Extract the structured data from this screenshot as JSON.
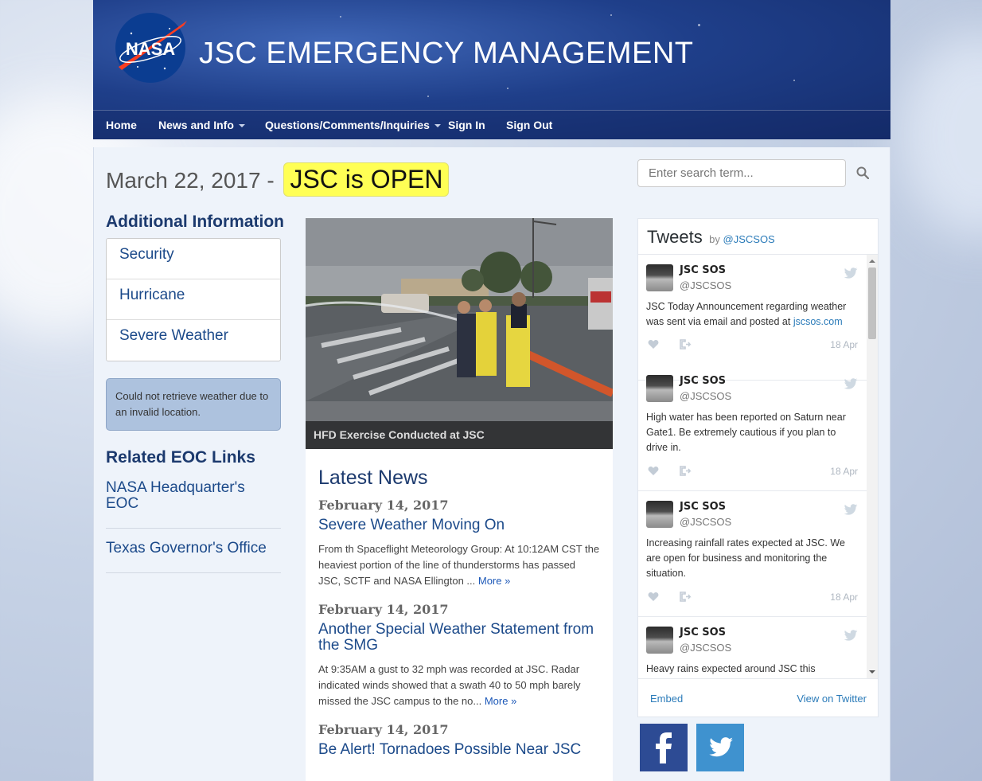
{
  "header": {
    "logo_text": "NASA",
    "title": "JSC EMERGENCY MANAGEMENT"
  },
  "nav": {
    "items": [
      {
        "label": "Home",
        "dropdown": false
      },
      {
        "label": "News and Info",
        "dropdown": true
      },
      {
        "label": "Questions/Comments/Inquiries",
        "dropdown": true
      },
      {
        "label": "Sign In",
        "dropdown": false
      },
      {
        "label": "Sign Out",
        "dropdown": false
      }
    ]
  },
  "status": {
    "date": "March 22, 2017 -",
    "badge": "JSC is OPEN",
    "badge_color": "#ffff55"
  },
  "search": {
    "placeholder": "Enter search term...",
    "icon": "search-icon"
  },
  "additional_info": {
    "title": "Additional Information",
    "items": [
      "Security",
      "Hurricane",
      "Severe Weather"
    ]
  },
  "weather": {
    "message": "Could not retrieve weather due to an invalid location."
  },
  "eoc": {
    "title": "Related EOC Links",
    "links": [
      "NASA Headquarter's EOC",
      "Texas Governor's Office"
    ]
  },
  "feature": {
    "caption": "HFD Exercise Conducted at JSC"
  },
  "news": {
    "title": "Latest News",
    "more_label": "More »",
    "items": [
      {
        "date": "February 14, 2017",
        "headline": "Severe Weather Moving On",
        "body": "From th Spaceflight Meteorology Group: At 10:12AM CST the heaviest portion of the line of thunderstorms has passed JSC, SCTF and NASA Ellington ..."
      },
      {
        "date": "February 14, 2017",
        "headline": "Another Special Weather Statement from the SMG",
        "body": "At 9:35AM a gust to 32 mph was recorded at JSC. Radar indicated winds showed that a swath 40 to 50 mph barely missed the JSC campus to the no..."
      },
      {
        "date": "February 14, 2017",
        "headline": "Be Alert! Tornadoes Possible Near JSC",
        "body": ""
      }
    ]
  },
  "tweets": {
    "title": "Tweets",
    "by": "by",
    "handle": "@JSCSOS",
    "embed_label": "Embed",
    "view_label": "View on Twitter",
    "items": [
      {
        "name": "JSC SOS",
        "handle": "@JSCSOS",
        "text": "JSC Today Announcement regarding weather was sent via email and posted at ",
        "link": "jscsos.com",
        "date": "18 Apr"
      },
      {
        "name": "JSC SOS",
        "handle": "@JSCSOS",
        "text": "High water has been reported on Saturn near Gate1. Be extremely cautious if you plan to drive in.",
        "link": "",
        "date": "18 Apr"
      },
      {
        "name": "JSC SOS",
        "handle": "@JSCSOS",
        "text": "Increasing rainfall rates expected at JSC. We are open for business and monitoring the situation.",
        "link": "",
        "date": "18 Apr"
      },
      {
        "name": "JSC SOS",
        "handle": "@JSCSOS",
        "text": "Heavy rains expected around JSC this",
        "link": "",
        "date": ""
      }
    ]
  },
  "social": {
    "facebook": "facebook-icon",
    "twitter": "twitter-icon",
    "facebook_color": "#2d4b94",
    "twitter_color": "#3f92cf"
  }
}
